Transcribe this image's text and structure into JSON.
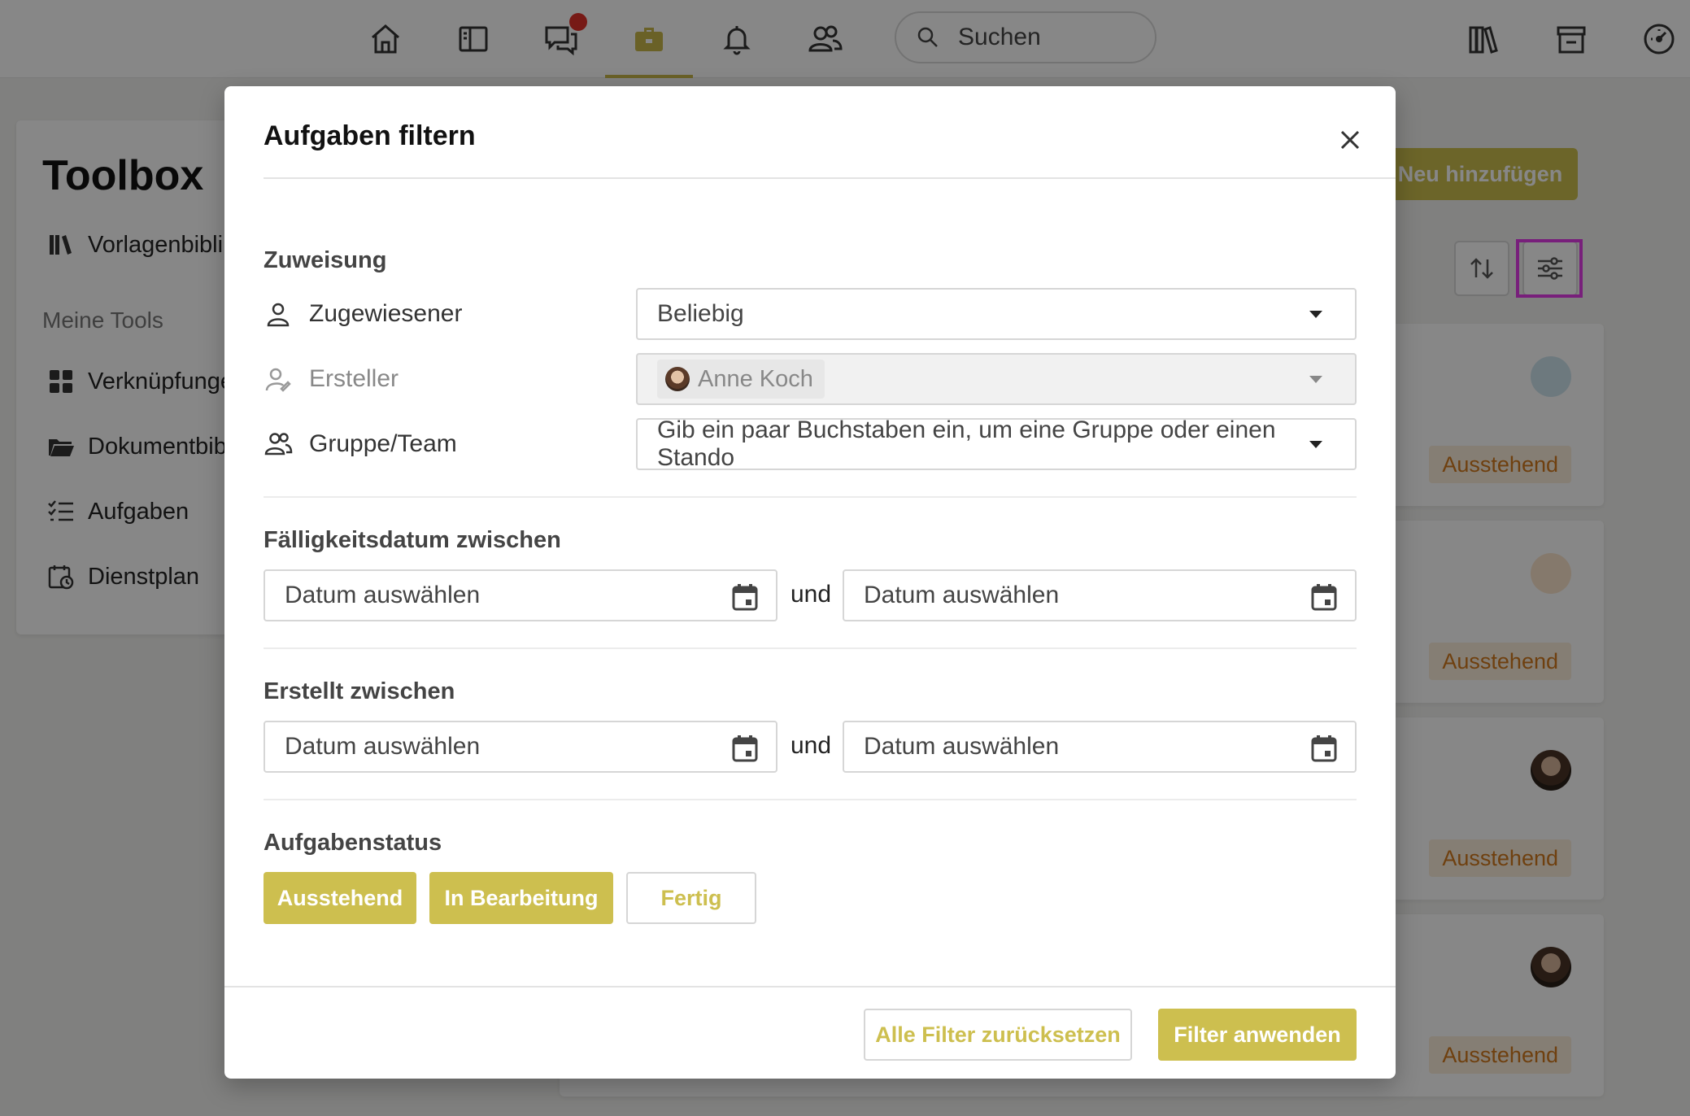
{
  "nav": {
    "search_placeholder": "Suchen",
    "icons": [
      "home-icon",
      "layout-icon",
      "chat-icon",
      "toolbox-icon",
      "bell-icon",
      "users-icon",
      "library-icon",
      "store-icon",
      "dashboard-icon"
    ]
  },
  "sidebar": {
    "title": "Toolbox",
    "library": "Vorlagenbibli",
    "section": "Meine Tools",
    "items": [
      {
        "label": "Verknüpfunge",
        "icon": "grid-icon"
      },
      {
        "label": "Dokumentbib",
        "icon": "folder-icon"
      },
      {
        "label": "Aufgaben",
        "icon": "checklist-icon"
      },
      {
        "label": "Dienstplan",
        "icon": "calendar-clock-icon"
      }
    ]
  },
  "page": {
    "add_button": "Neu hinzufügen",
    "tasks": [
      {
        "status": "Ausstehend"
      },
      {
        "status": "Ausstehend"
      },
      {
        "status": "Ausstehend"
      },
      {
        "status": "Ausstehend"
      }
    ]
  },
  "modal": {
    "title": "Aufgaben filtern",
    "assignment": {
      "heading": "Zuweisung",
      "assignee_label": "Zugewiesener",
      "assignee_value": "Beliebig",
      "creator_label": "Ersteller",
      "creator_value": "Anne Koch",
      "group_label": "Gruppe/Team",
      "group_placeholder": "Gib ein paar Buchstaben ein, um eine Gruppe oder einen Stando"
    },
    "due": {
      "heading": "Fälligkeitsdatum zwischen",
      "from_placeholder": "Datum auswählen",
      "and": "und",
      "to_placeholder": "Datum auswählen"
    },
    "created": {
      "heading": "Erstellt zwischen",
      "from_placeholder": "Datum auswählen",
      "and": "und",
      "to_placeholder": "Datum auswählen"
    },
    "status": {
      "heading": "Aufgabenstatus",
      "options": [
        {
          "label": "Ausstehend",
          "selected": true
        },
        {
          "label": "In Bearbeitung",
          "selected": true
        },
        {
          "label": "Fertig",
          "selected": false
        }
      ]
    },
    "reset_button": "Alle Filter zurücksetzen",
    "apply_button": "Filter anwenden"
  },
  "colors": {
    "accent": "#cdbf4f",
    "pending_text": "#d17a1e",
    "pending_bg": "#fbeedc",
    "highlight": "#e23be8",
    "notification": "#e0322b"
  }
}
